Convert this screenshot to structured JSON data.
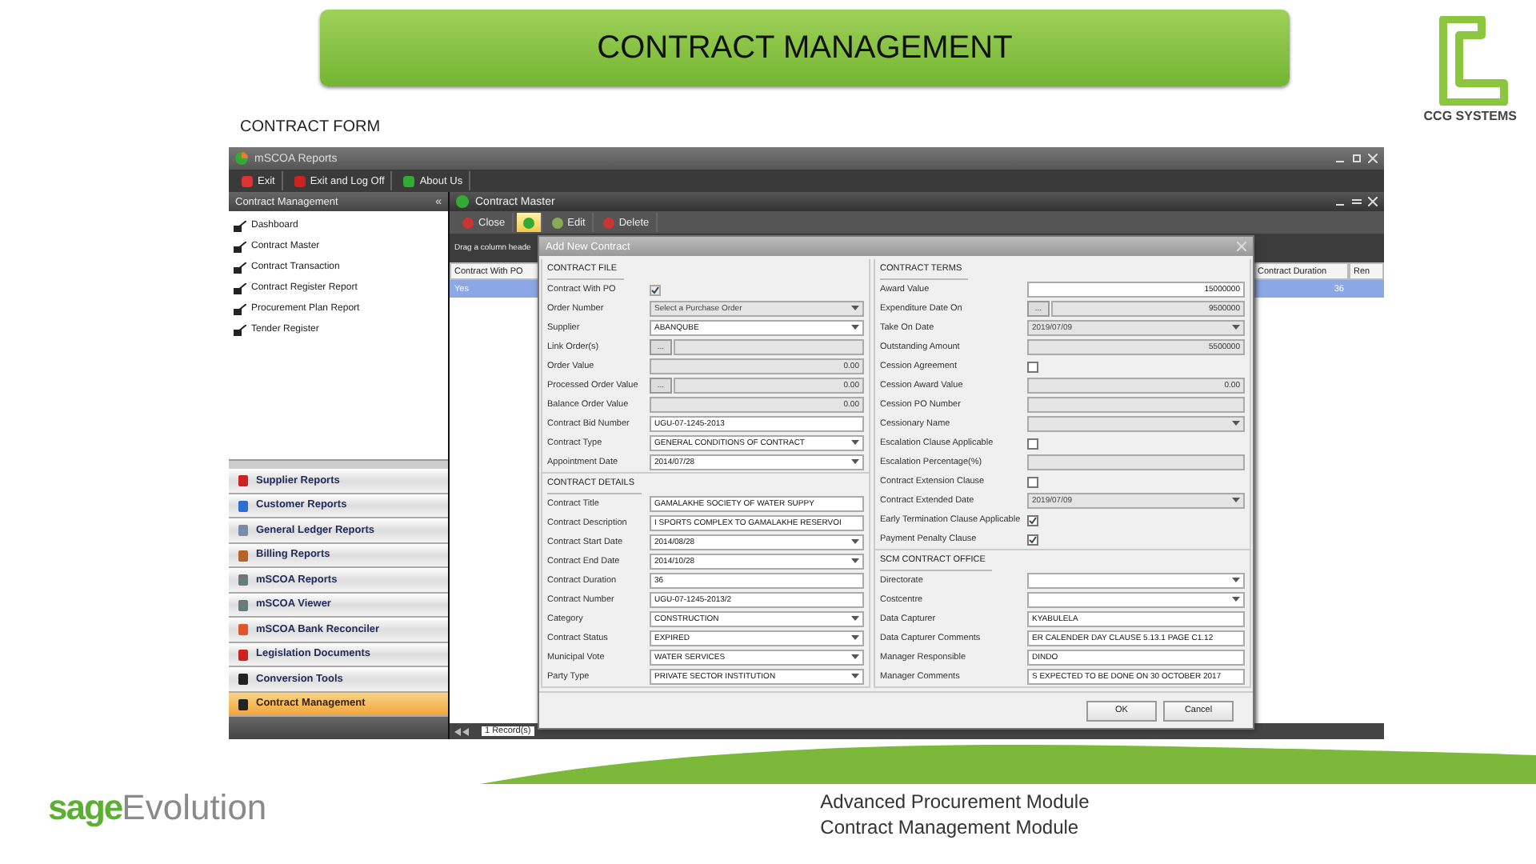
{
  "slide": {
    "title": "CONTRACT MANAGEMENT",
    "logo_text": "CCG SYSTEMS",
    "subtitle": "CONTRACT FORM",
    "brand": {
      "first": "sage",
      "second": "Evolution"
    },
    "captions": [
      "Advanced Procurement Module",
      "Contract Management Module"
    ]
  },
  "app": {
    "title": "mSCOA Reports",
    "toolbar": [
      {
        "label": "Exit"
      },
      {
        "label": "Exit and Log Off"
      },
      {
        "label": "About Us"
      }
    ],
    "sidebar": {
      "title": "Contract Management",
      "collapse": "«",
      "items": [
        {
          "label": "Dashboard"
        },
        {
          "label": "Contract Master"
        },
        {
          "label": "Contract Transaction"
        },
        {
          "label": "Contract Register Report"
        },
        {
          "label": "Procurement Plan Report"
        },
        {
          "label": "Tender Register"
        }
      ],
      "modules": [
        {
          "label": "Supplier Reports",
          "selected": false
        },
        {
          "label": "Customer Reports",
          "selected": false
        },
        {
          "label": "General Ledger Reports",
          "selected": false
        },
        {
          "label": "Billing Reports",
          "selected": false
        },
        {
          "label": "mSCOA Reports",
          "selected": false
        },
        {
          "label": "mSCOA Viewer",
          "selected": false
        },
        {
          "label": "mSCOA Bank Reconciler",
          "selected": false
        },
        {
          "label": "Legislation Documents",
          "selected": false
        },
        {
          "label": "Conversion Tools",
          "selected": false
        },
        {
          "label": "Contract Management",
          "selected": true
        }
      ]
    },
    "document": {
      "title": "Contract Master",
      "toolbar": [
        {
          "label": "Close",
          "selected": false
        },
        {
          "selected": true
        },
        {
          "label": "Edit",
          "selected": false
        },
        {
          "label": "Delete",
          "selected": false
        }
      ],
      "grid": {
        "group_hint": "Drag a column heade",
        "columns": [
          "Contract With PO",
          "Contract Duration",
          "Ren"
        ],
        "row": {
          "contract_with_po": "Yes",
          "contract_duration": "36",
          "selected": true
        },
        "footer": "1 Record(s)"
      },
      "dialog": {
        "title": "Add New Contract",
        "columns": [
          [
            {
              "title": "CONTRACT FILE",
              "fields": [
                {
                  "label": "Contract With PO",
                  "kind": "checkbox",
                  "checked": true,
                  "disabled": true
                },
                {
                  "label": "Order Number",
                  "kind": "dropdown",
                  "value": "Select a Purchase Order",
                  "disabled": true
                },
                {
                  "label": "Supplier",
                  "kind": "dropdown",
                  "value": "ABANQUBE",
                  "disabled": false
                },
                {
                  "label": "Link Order(s)",
                  "kind": "ellipsis",
                  "button": "...",
                  "disabled": true
                },
                {
                  "label": "Order Value",
                  "kind": "number",
                  "value": "0.00",
                  "disabled": true
                },
                {
                  "label": "Processed Order Value",
                  "kind": "ellipsis",
                  "button": "...",
                  "value": "0.00",
                  "disabled": true
                },
                {
                  "label": "Balance Order Value",
                  "kind": "number",
                  "value": "0.00",
                  "disabled": true
                },
                {
                  "label": "Contract Bid Number",
                  "kind": "text",
                  "value": "UGU-07-1245-2013",
                  "disabled": false
                },
                {
                  "label": "Contract Type",
                  "kind": "dropdown",
                  "value": "GENERAL CONDITIONS OF CONTRACT",
                  "disabled": false
                },
                {
                  "label": "Appointment Date",
                  "kind": "dropdown",
                  "value": "2014/07/28",
                  "disabled": false
                }
              ]
            },
            {
              "title": "CONTRACT DETAILS",
              "fields": [
                {
                  "label": "Contract Title",
                  "kind": "text",
                  "value": "GAMALAKHE SOCIETY OF WATER SUPPY",
                  "disabled": false
                },
                {
                  "label": "Contract Description",
                  "kind": "text",
                  "value": "I SPORTS COMPLEX TO GAMALAKHE RESERVOI",
                  "disabled": false
                },
                {
                  "label": "Contract Start Date",
                  "kind": "dropdown",
                  "value": "2014/08/28",
                  "disabled": false
                },
                {
                  "label": "Contract End Date",
                  "kind": "dropdown",
                  "value": "2014/10/28",
                  "disabled": false
                },
                {
                  "label": "Contract Duration",
                  "kind": "text",
                  "value": "36",
                  "disabled": false
                },
                {
                  "label": "Contract Number",
                  "kind": "text",
                  "value": "UGU-07-1245-2013/2",
                  "disabled": false
                },
                {
                  "label": "Category",
                  "kind": "dropdown",
                  "value": "CONSTRUCTION",
                  "disabled": false
                },
                {
                  "label": "Contract Status",
                  "kind": "dropdown",
                  "value": "EXPIRED",
                  "disabled": false
                },
                {
                  "label": "Municipal Vote",
                  "kind": "dropdown",
                  "value": "WATER SERVICES",
                  "disabled": false
                },
                {
                  "label": "Party Type",
                  "kind": "dropdown",
                  "value": "PRIVATE SECTOR INSTITUTION",
                  "disabled": false
                }
              ]
            }
          ],
          [
            {
              "title": "CONTRACT TERMS",
              "fields": [
                {
                  "label": "Award Value",
                  "kind": "number",
                  "value": "15000000",
                  "disabled": false
                },
                {
                  "label": "Expenditure Date On",
                  "kind": "ellipsis",
                  "button": "...",
                  "value": "9500000",
                  "disabled": true
                },
                {
                  "label": "Take On Date",
                  "kind": "dropdown",
                  "value": "2019/07/09",
                  "disabled": true
                },
                {
                  "label": "Outstanding Amount",
                  "kind": "number",
                  "value": "5500000",
                  "disabled": true
                },
                {
                  "label": "Cession Agreement",
                  "kind": "checkbox",
                  "checked": false,
                  "disabled": false
                },
                {
                  "label": "Cession Award Value",
                  "kind": "number",
                  "value": "0.00",
                  "disabled": true
                },
                {
                  "label": "Cession PO Number",
                  "kind": "text",
                  "disabled": true
                },
                {
                  "label": "Cessionary Name",
                  "kind": "dropdown",
                  "disabled": true
                },
                {
                  "label": "Escalation Clause Applicable",
                  "kind": "checkbox",
                  "checked": false,
                  "disabled": false
                },
                {
                  "label": "Escalation Percentage(%)",
                  "kind": "text",
                  "disabled": true
                },
                {
                  "label": "Contract Extension Clause",
                  "kind": "checkbox",
                  "checked": false,
                  "disabled": false
                },
                {
                  "label": "Contract Extended Date",
                  "kind": "dropdown",
                  "value": "2019/07/09",
                  "disabled": true
                },
                {
                  "label": "Early Termination Clause Applicable",
                  "kind": "checkbox",
                  "checked": true,
                  "disabled": false
                },
                {
                  "label": "Payment Penalty Clause",
                  "kind": "checkbox",
                  "checked": true,
                  "disabled": false
                }
              ]
            },
            {
              "title": "SCM CONTRACT OFFICE",
              "fields": [
                {
                  "label": "Directorate",
                  "kind": "dropdown",
                  "disabled": false
                },
                {
                  "label": "Costcentre",
                  "kind": "dropdown",
                  "disabled": false
                },
                {
                  "label": "Data Capturer",
                  "kind": "text",
                  "value": "KYABULELA",
                  "disabled": false
                },
                {
                  "label": "Data Capturer Comments",
                  "kind": "text",
                  "value": "ER CALENDER DAY CLAUSE 5.13.1 PAGE C1.12",
                  "disabled": false
                },
                {
                  "label": "Manager Responsible",
                  "kind": "text",
                  "value": "DINDO",
                  "disabled": false
                },
                {
                  "label": "Manager Comments",
                  "kind": "text",
                  "value": "S EXPECTED TO BE DONE ON 30 OCTOBER 2017",
                  "disabled": false
                }
              ]
            }
          ]
        ],
        "buttons": [
          "OK",
          "Cancel"
        ]
      }
    }
  }
}
